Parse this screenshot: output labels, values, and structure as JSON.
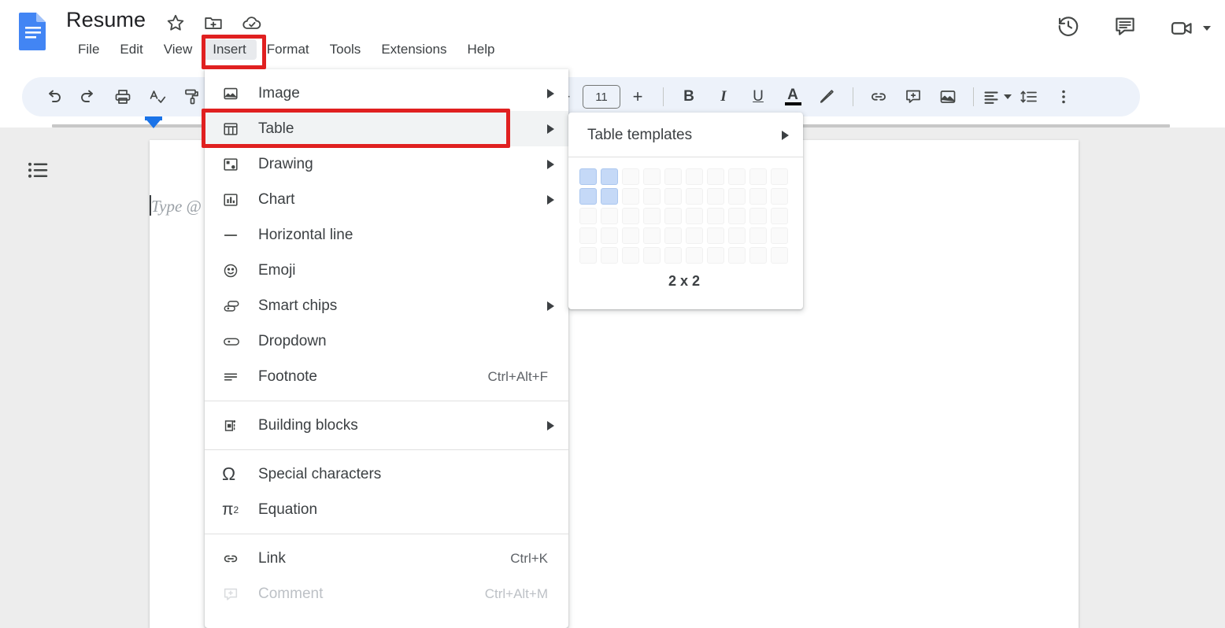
{
  "app": {
    "doc_title": "Resume",
    "logo_color": "#4285F4",
    "accent_color": "#1a73e8",
    "highlight_color": "#e02020"
  },
  "title_icons": [
    {
      "name": "star-icon",
      "label": "Star"
    },
    {
      "name": "move-folder-icon",
      "label": "Move to folder"
    },
    {
      "name": "cloud-saved-icon",
      "label": "Saved to Drive"
    }
  ],
  "menubar": {
    "items": [
      {
        "label": "File",
        "active": false
      },
      {
        "label": "Edit",
        "active": false
      },
      {
        "label": "View",
        "active": false
      },
      {
        "label": "Insert",
        "active": true
      },
      {
        "label": "Format",
        "active": false
      },
      {
        "label": "Tools",
        "active": false
      },
      {
        "label": "Extensions",
        "active": false
      },
      {
        "label": "Help",
        "active": false
      }
    ]
  },
  "toolbar": {
    "font_size": "11",
    "decrease_label": "−",
    "increase_label": "+",
    "bold_label": "B",
    "italic_label": "I",
    "underline_label": "U",
    "text_color_label": "A",
    "items": [
      "undo-icon",
      "redo-icon",
      "print-icon",
      "spellcheck-icon",
      "paint-format-icon",
      "image-icon",
      "decrease-font-size",
      "font-size-input",
      "increase-font-size",
      "bold",
      "italic",
      "underline",
      "text-color",
      "highlight-color",
      "insert-link",
      "add-comment",
      "insert-image",
      "align",
      "line-spacing",
      "more-options"
    ]
  },
  "top_right_icons": [
    {
      "name": "version-history-icon",
      "label": "Version history"
    },
    {
      "name": "show-comments-icon",
      "label": "Open comment history"
    },
    {
      "name": "video-call-icon",
      "label": "Join a call"
    }
  ],
  "document": {
    "placeholder": "Type @",
    "outline_icon": "document-outline-icon"
  },
  "insert_menu": {
    "items": [
      {
        "label": "Image",
        "icon": "image-icon",
        "arrow": true,
        "shortcut": "",
        "selected": false,
        "disabled": false
      },
      {
        "label": "Table",
        "icon": "table-icon",
        "arrow": true,
        "shortcut": "",
        "selected": true,
        "disabled": false
      },
      {
        "label": "Drawing",
        "icon": "drawing-icon",
        "arrow": true,
        "shortcut": "",
        "selected": false,
        "disabled": false
      },
      {
        "label": "Chart",
        "icon": "chart-icon",
        "arrow": true,
        "shortcut": "",
        "selected": false,
        "disabled": false
      },
      {
        "label": "Horizontal line",
        "icon": "horizontal-line-icon",
        "arrow": false,
        "shortcut": "",
        "selected": false,
        "disabled": false
      },
      {
        "label": "Emoji",
        "icon": "emoji-icon",
        "arrow": false,
        "shortcut": "",
        "selected": false,
        "disabled": false
      },
      {
        "label": "Smart chips",
        "icon": "smart-chips-icon",
        "arrow": true,
        "shortcut": "",
        "selected": false,
        "disabled": false
      },
      {
        "label": "Dropdown",
        "icon": "dropdown-icon",
        "arrow": false,
        "shortcut": "",
        "selected": false,
        "disabled": false
      },
      {
        "label": "Footnote",
        "icon": "footnote-icon",
        "arrow": false,
        "shortcut": "Ctrl+Alt+F",
        "selected": false,
        "disabled": false
      },
      {
        "divider": true
      },
      {
        "label": "Building blocks",
        "icon": "building-blocks-icon",
        "arrow": true,
        "shortcut": "",
        "selected": false,
        "disabled": false
      },
      {
        "divider": true
      },
      {
        "label": "Special characters",
        "icon": "omega-icon",
        "arrow": false,
        "shortcut": "",
        "selected": false,
        "disabled": false
      },
      {
        "label": "Equation",
        "icon": "equation-icon",
        "arrow": false,
        "shortcut": "",
        "selected": false,
        "disabled": false
      },
      {
        "divider": true
      },
      {
        "label": "Link",
        "icon": "link-icon",
        "arrow": false,
        "shortcut": "Ctrl+K",
        "selected": false,
        "disabled": false
      },
      {
        "label": "Comment",
        "icon": "comment-icon",
        "arrow": false,
        "shortcut": "Ctrl+Alt+M",
        "selected": false,
        "disabled": true
      }
    ]
  },
  "table_submenu": {
    "templates_label": "Table templates",
    "grid": {
      "columns": 10,
      "rows": 5,
      "selected_columns": 2,
      "selected_rows": 2,
      "size_label": "2 x 2",
      "selected_color": "#c5d9f7"
    }
  }
}
